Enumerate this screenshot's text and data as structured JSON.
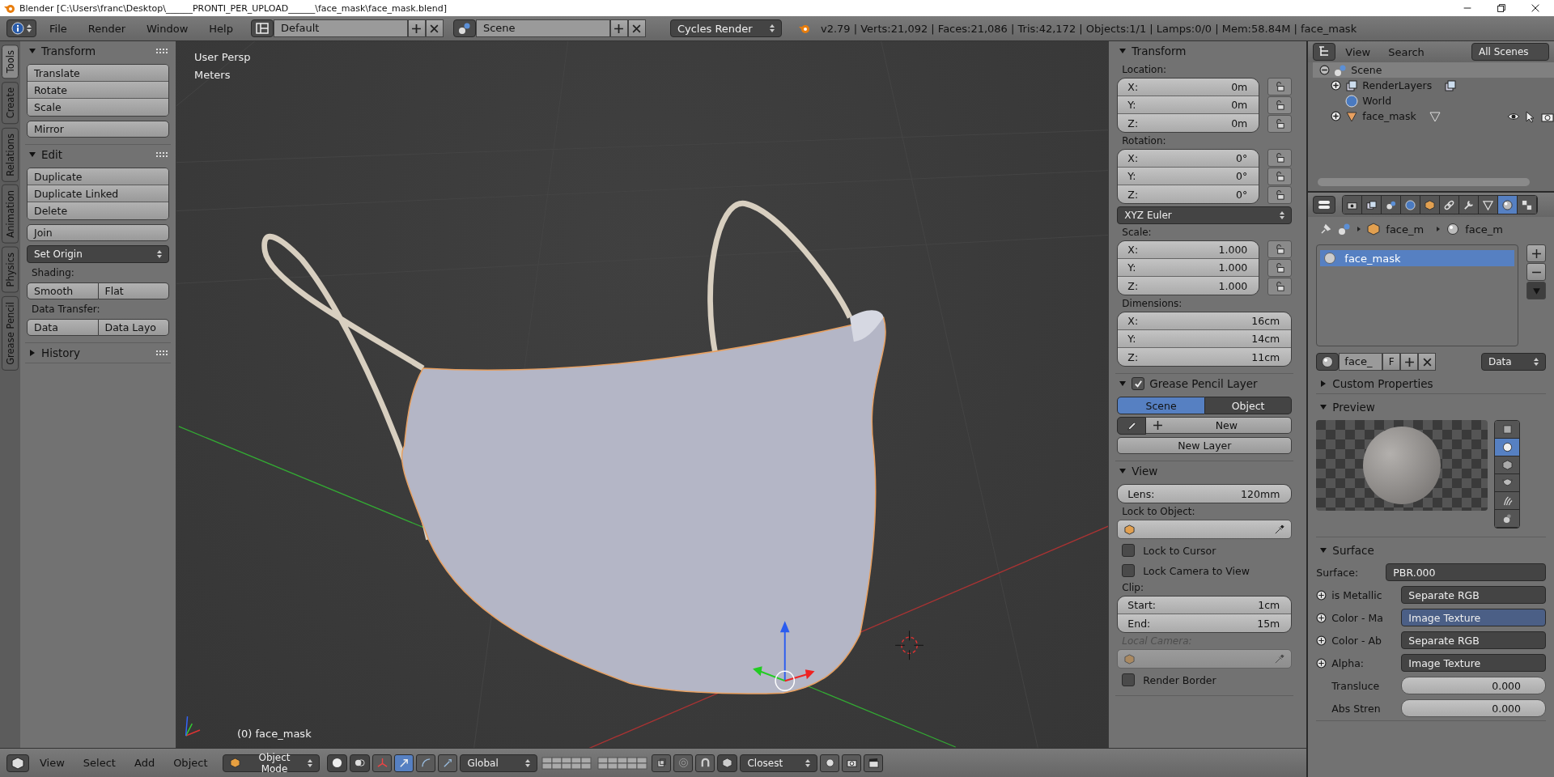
{
  "window": {
    "title": "Blender [C:\\Users\\franc\\Desktop\\______PRONTI_PER_UPLOAD______\\face_mask\\face_mask.blend]"
  },
  "info_header": {
    "menus": [
      "File",
      "Render",
      "Window",
      "Help"
    ],
    "layout": "Default",
    "scene": "Scene",
    "engine": "Cycles Render",
    "stats": "v2.79 | Verts:21,092 | Faces:21,086 | Tris:42,172 | Objects:1/1 | Lamps:0/0 | Mem:58.84M | face_mask"
  },
  "tool_tabs": [
    {
      "label": "Tools",
      "selected": true
    },
    {
      "label": "Create",
      "selected": false
    },
    {
      "label": "Relations",
      "selected": false
    },
    {
      "label": "Animation",
      "selected": false
    },
    {
      "label": "Physics",
      "selected": false
    },
    {
      "label": "Grease Pencil",
      "selected": false
    }
  ],
  "tool_shelf": [
    {
      "title": "Transform",
      "expanded": true,
      "items": [
        {
          "kind": "column",
          "buttons": [
            "Translate",
            "Rotate",
            "Scale"
          ]
        },
        {
          "kind": "button",
          "label": "Mirror"
        }
      ]
    },
    {
      "title": "Edit",
      "expanded": true,
      "items": [
        {
          "kind": "column",
          "buttons": [
            "Duplicate",
            "Duplicate Linked",
            "Delete"
          ]
        },
        {
          "kind": "button",
          "label": "Join"
        },
        {
          "kind": "dropdown",
          "label": "Set Origin"
        },
        {
          "kind": "label",
          "label": "Shading:"
        },
        {
          "kind": "row",
          "buttons": [
            "Smooth",
            "Flat"
          ]
        },
        {
          "kind": "label",
          "label": "Data Transfer:"
        },
        {
          "kind": "row",
          "buttons": [
            "Data",
            "Data Layo"
          ]
        }
      ]
    },
    {
      "title": "History",
      "expanded": false
    }
  ],
  "viewport": {
    "view_name": "User Persp",
    "units": "Meters",
    "object_label": "(0) face_mask"
  },
  "n_panel": [
    {
      "title": "Transform",
      "expanded": true,
      "items": [
        {
          "kind": "label",
          "label": "Location:",
          "disabled": false
        },
        {
          "kind": "locked_fields",
          "fields": [
            {
              "label": "X:",
              "value": "0m"
            },
            {
              "label": "Y:",
              "value": "0m"
            },
            {
              "label": "Z:",
              "value": "0m"
            }
          ]
        },
        {
          "kind": "label",
          "label": "Rotation:",
          "disabled": false
        },
        {
          "kind": "locked_fields",
          "fields": [
            {
              "label": "X:",
              "value": "0°"
            },
            {
              "label": "Y:",
              "value": "0°"
            },
            {
              "label": "Z:",
              "value": "0°"
            }
          ]
        },
        {
          "kind": "dropdown",
          "label": "XYZ Euler"
        },
        {
          "kind": "label",
          "label": "Scale:",
          "disabled": false
        },
        {
          "kind": "locked_fields",
          "fields": [
            {
              "label": "X:",
              "value": "1.000"
            },
            {
              "label": "Y:",
              "value": "1.000"
            },
            {
              "label": "Z:",
              "value": "1.000"
            }
          ]
        },
        {
          "kind": "label",
          "label": "Dimensions:",
          "disabled": false
        },
        {
          "kind": "fields",
          "fields": [
            {
              "label": "X:",
              "value": "16cm"
            },
            {
              "label": "Y:",
              "value": "14cm"
            },
            {
              "label": "Z:",
              "value": "11cm"
            }
          ]
        }
      ]
    },
    {
      "title": "Grease Pencil Layer",
      "expanded": true,
      "checked": true,
      "items": [
        {
          "kind": "toggle",
          "options": [
            {
              "label": "Scene",
              "selected": true
            },
            {
              "label": "Object",
              "selected": false
            }
          ]
        },
        {
          "kind": "new_row",
          "label": "New"
        },
        {
          "kind": "button",
          "label": "New Layer"
        }
      ]
    },
    {
      "title": "View",
      "expanded": true,
      "items": [
        {
          "kind": "fields",
          "fields": [
            {
              "label": "Lens:",
              "value": "120mm"
            }
          ]
        },
        {
          "kind": "label",
          "label": "Lock to Object:",
          "disabled": false
        },
        {
          "kind": "object_field",
          "disabled": false
        },
        {
          "kind": "checkbox",
          "label": "Lock to Cursor",
          "checked": false
        },
        {
          "kind": "checkbox",
          "label": "Lock Camera to View",
          "checked": false
        },
        {
          "kind": "label",
          "label": "Clip:",
          "disabled": false
        },
        {
          "kind": "fields",
          "fields": [
            {
              "label": "Start:",
              "value": "1cm"
            },
            {
              "label": "End:",
              "value": "15m"
            }
          ]
        },
        {
          "kind": "label",
          "label": "Local Camera:",
          "disabled": true
        },
        {
          "kind": "object_field",
          "disabled": true
        },
        {
          "kind": "checkbox",
          "label": "Render Border",
          "checked": false
        }
      ]
    }
  ],
  "outliner": {
    "menus": [
      "View",
      "Search"
    ],
    "filter": "All Scenes",
    "tree": [
      {
        "name": "Scene",
        "kind": "scene",
        "selected": true,
        "expanded": true,
        "children": [
          {
            "name": "RenderLayers",
            "kind": "renderlayers",
            "selected": false,
            "expanded": false
          },
          {
            "name": "World",
            "kind": "world",
            "selected": false
          },
          {
            "name": "face_mask",
            "kind": "mesh_object",
            "selected": false,
            "expanded": false
          }
        ]
      }
    ]
  },
  "properties": {
    "tabs": [
      {
        "kind": "render",
        "selected": false
      },
      {
        "kind": "layers",
        "selected": false
      },
      {
        "kind": "scene",
        "selected": false
      },
      {
        "kind": "world",
        "selected": false
      },
      {
        "kind": "object",
        "selected": false
      },
      {
        "kind": "constraints",
        "selected": false
      },
      {
        "kind": "modifiers",
        "selected": false
      },
      {
        "kind": "data",
        "selected": false
      },
      {
        "kind": "material",
        "selected": true
      },
      {
        "kind": "texture",
        "selected": false
      }
    ],
    "breadcrumb": [
      "face_m",
      "face_m"
    ],
    "slots": [
      {
        "name": "face_mask",
        "selected": true
      }
    ],
    "datablock": {
      "name": "face_",
      "fake_user": "F",
      "link": "Data"
    },
    "panels": [
      {
        "title": "Custom Properties",
        "expanded": false
      },
      {
        "kind": "preview",
        "title": "Preview",
        "expanded": true,
        "shapes": [
          {
            "kind": "flat",
            "selected": false
          },
          {
            "kind": "sphere",
            "selected": true
          },
          {
            "kind": "cube",
            "selected": false
          },
          {
            "kind": "monkey",
            "selected": false
          },
          {
            "kind": "hair",
            "selected": false
          },
          {
            "kind": "sky",
            "selected": false
          }
        ]
      },
      {
        "kind": "surface",
        "title": "Surface",
        "expanded": true,
        "surface": {
          "label": "Surface:",
          "value": "PBR.000"
        },
        "inputs": [
          {
            "kind": "link",
            "label": "is Metallic",
            "value": "Separate RGB",
            "highlighted": false
          },
          {
            "kind": "link",
            "label": "Color - Ma",
            "value": "Image Texture",
            "highlighted": true
          },
          {
            "kind": "link",
            "label": "Color - Ab",
            "value": "Separate RGB",
            "highlighted": false
          },
          {
            "kind": "link",
            "label": "Alpha:",
            "value": "Image Texture",
            "highlighted": false
          },
          {
            "kind": "number",
            "label": "Transluce",
            "value": "0.000"
          },
          {
            "kind": "number",
            "label": "Abs Stren",
            "value": "0.000"
          }
        ]
      }
    ]
  },
  "view3d_header": {
    "menus": [
      "View",
      "Select",
      "Add",
      "Object"
    ],
    "mode": "Object Mode",
    "orientation": "Global",
    "snap": "Closest"
  }
}
